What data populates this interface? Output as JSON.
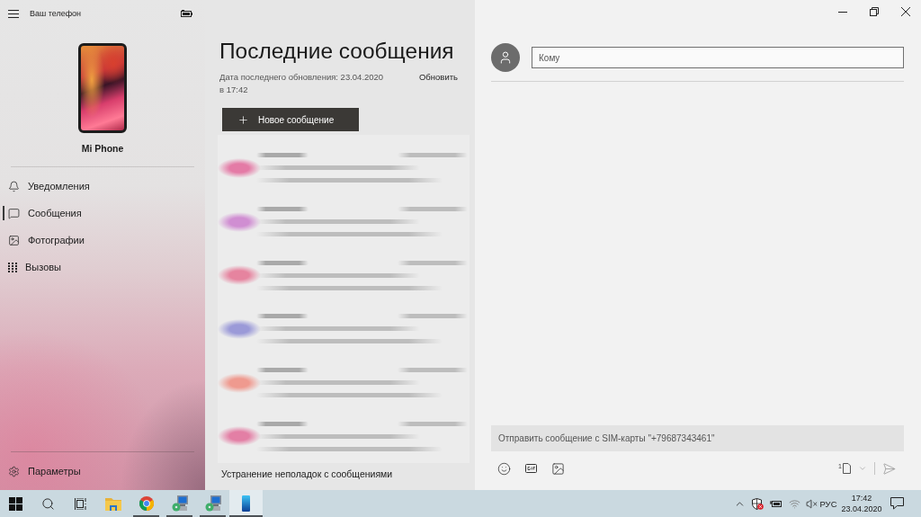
{
  "sidebar": {
    "title": "Ваш телефон",
    "device_name": "Mi Phone",
    "nav": [
      {
        "kind": "notifications",
        "label": "Уведомления",
        "selected": false
      },
      {
        "kind": "messages",
        "label": "Сообщения",
        "selected": true
      },
      {
        "kind": "photos",
        "label": "Фотографии",
        "selected": false
      },
      {
        "kind": "calls",
        "label": "Вызовы",
        "selected": false
      }
    ],
    "settings": {
      "label": "Параметры"
    }
  },
  "messages": {
    "title": "Последние сообщения",
    "updated": "Дата последнего обновления: 23.04.2020 в 17:42",
    "refresh": "Обновить",
    "new_message": "Новое сообщение",
    "conversations": [
      {
        "color": "#e47ba6"
      },
      {
        "color": "#d08ed2"
      },
      {
        "color": "#e6849f"
      },
      {
        "color": "#9b9ad8"
      },
      {
        "color": "#ef9a8f"
      },
      {
        "color": "#e37fa5"
      }
    ],
    "troubleshoot": "Устранение неполадок с сообщениями"
  },
  "compose": {
    "to": {
      "placeholder": "Кому"
    },
    "message": {
      "placeholder": "Отправить сообщение с SIM-карты \"+79687343461\""
    },
    "sim": "1"
  },
  "taskbar": {
    "apps": [
      {
        "kind": "start",
        "running": false,
        "selected": false
      },
      {
        "kind": "search",
        "running": false,
        "selected": false
      },
      {
        "kind": "task-view",
        "running": false,
        "selected": false
      },
      {
        "kind": "explorer",
        "running": false,
        "selected": false
      },
      {
        "kind": "browser",
        "running": true,
        "selected": false
      },
      {
        "kind": "installer",
        "running": true,
        "selected": false
      },
      {
        "kind": "installer",
        "running": true,
        "selected": false
      },
      {
        "kind": "phone",
        "running": true,
        "selected": true
      }
    ],
    "tray": {
      "volume_muted": true,
      "language": "РУС",
      "time": "17:42",
      "date": "23.04.2020"
    }
  }
}
